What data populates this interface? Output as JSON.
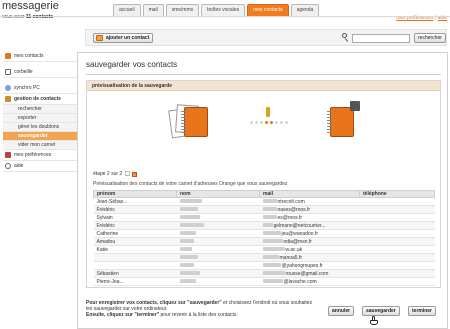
{
  "app": {
    "title": "messagerie",
    "subtitle_prefix": "vous avez",
    "subtitle_count": "11 contacts"
  },
  "tabs": [
    {
      "label": "accueil",
      "active": false
    },
    {
      "label": "mail",
      "active": false
    },
    {
      "label": "sms/mms",
      "active": false
    },
    {
      "label": "boîtes vocales",
      "active": false
    },
    {
      "label": "mes contacts",
      "active": true
    },
    {
      "label": "agenda",
      "active": false
    }
  ],
  "top_links": {
    "preferences": "mes préférences",
    "separator": "|",
    "help": "aide"
  },
  "toolbar": {
    "add_contact": "ajouter un contact",
    "search_placeholder": "",
    "search_button": "rechercher"
  },
  "sidebar": {
    "items": [
      {
        "label": "mes contacts",
        "icon": "contacts-icon"
      },
      {
        "label": "corbeille",
        "icon": "trash-icon"
      },
      {
        "label": "synchro PC",
        "icon": "sync-icon"
      },
      {
        "label": "gestion de contacts",
        "icon": "manage-icon"
      }
    ],
    "sub_items": [
      {
        "label": "rechercher",
        "active": false
      },
      {
        "label": "exporter",
        "active": false
      },
      {
        "label": "gérer les doublons",
        "active": false
      },
      {
        "label": "sauvegarder",
        "active": true
      },
      {
        "label": "vider mon carnet",
        "active": false
      }
    ],
    "bottom_items": [
      {
        "label": "mes préférences",
        "icon": "preferences-icon"
      },
      {
        "label": "aide",
        "icon": "help-icon"
      }
    ]
  },
  "main": {
    "title": "sauvegarder vos contacts",
    "panel_title": "prévisualisation de la sauvegarde",
    "step_label": "étape 2 sur 2",
    "step_current": "2",
    "preview_note": "Prévisualisation des contacts de votre carnet d'adresses Orange que vous sauvegardez",
    "table": {
      "headers": [
        "prénom",
        "nom",
        "mail",
        "téléphone"
      ],
      "rows": [
        {
          "prenom": "Jean-Sébas...",
          "nom": "",
          "mail": "ntrecolt.com",
          "tel": ""
        },
        {
          "prenom": "Frédéric",
          "nom": "",
          "mail": "nases@roos.fr",
          "tel": ""
        },
        {
          "prenom": "Sylvain",
          "nom": "",
          "mail": "es@roos.fr",
          "tel": ""
        },
        {
          "prenom": "Frédéric",
          "nom": "",
          "mail": "gelmann@netcourrier...",
          "tel": ""
        },
        {
          "prenom": "Catherine",
          "nom": "",
          "mail": "jeu@wanadoo.fr",
          "tel": ""
        },
        {
          "prenom": "Amadou",
          "nom": "",
          "mail": "ndia@msn.fr",
          "tel": ""
        },
        {
          "prenom": "Katie",
          "nom": "",
          "mail": "w.ac.uk",
          "tel": ""
        },
        {
          "prenom": "",
          "nom": "",
          "mail": "manoa5.fr",
          "tel": ""
        },
        {
          "prenom": "",
          "nom": "",
          "mail": "@yahoogroupes.fr",
          "tel": ""
        },
        {
          "prenom": "Sébastien",
          "nom": "",
          "mail": "rousse@gmail.com",
          "tel": ""
        },
        {
          "prenom": "Pierre-Jea...",
          "nom": "",
          "mail": "@lavache.com",
          "tel": ""
        }
      ]
    },
    "instructions": {
      "line1_a": "Pour enregistrer vos contacts, cliquez sur",
      "line1_b": "\"sauvegarder\"",
      "line1_c": "et choisissez l'endroit où vous souhaitez",
      "line2": "les sauvegarder sur votre ordinateur.",
      "line3_a": "Ensuite, cliquez sur",
      "line3_b": "\"terminer\"",
      "line3_c": "pour revenir à la liste des contacts."
    },
    "buttons": {
      "cancel": "annuler",
      "save": "sauvegarder",
      "finish": "terminer"
    }
  },
  "colors": {
    "accent": "#e8741c",
    "panel_header": "#f3e4d1",
    "active_sub": "#f3a451"
  }
}
